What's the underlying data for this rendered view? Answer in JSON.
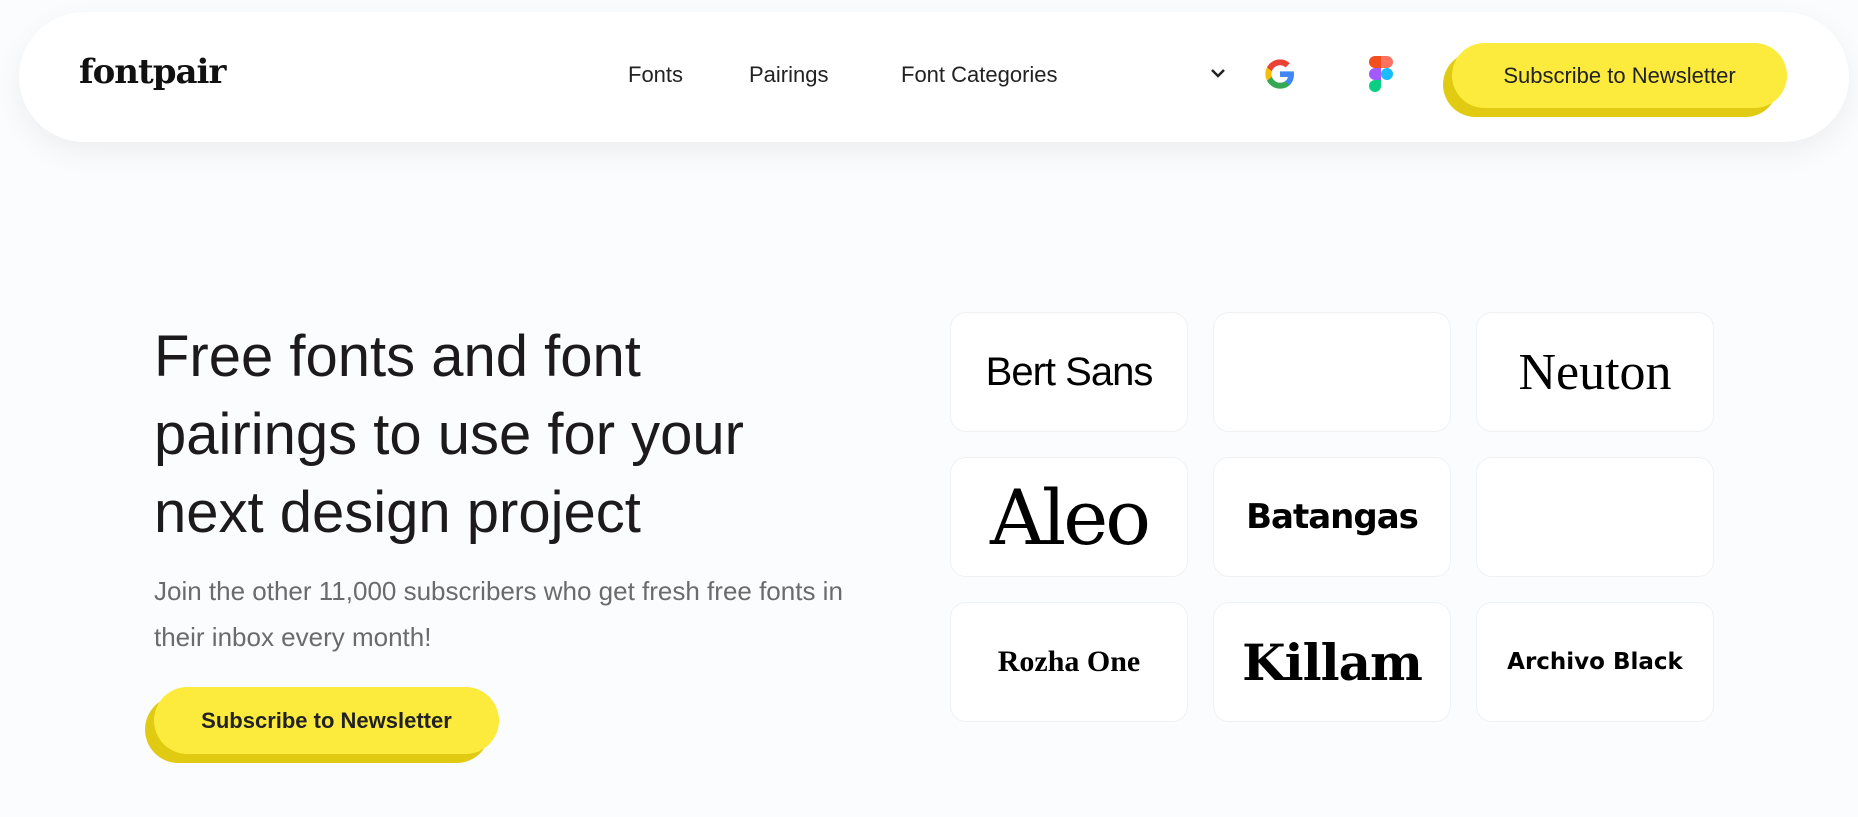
{
  "nav": {
    "logo": "fontpair",
    "links": [
      "Fonts",
      "Pairings",
      "Font Categories"
    ],
    "google_icon": "google-icon",
    "figma_icon": "figma-icon",
    "subscribe": "Subscribe to Newsletter"
  },
  "hero": {
    "title": "Free fonts and font pairings to use for your next design project",
    "subtitle": "Join the other 11,000 subscribers who get fresh free fonts in their inbox every month!",
    "cta": "Subscribe to Newsletter"
  },
  "fonts": [
    "Bert Sans",
    "",
    "Neuton",
    "Aleo",
    "Batangas",
    "",
    "Rozha One",
    "Killam",
    "Archivo Black"
  ],
  "colors": {
    "accent": "#fceb3c",
    "accent_shadow": "#e0cb12"
  }
}
